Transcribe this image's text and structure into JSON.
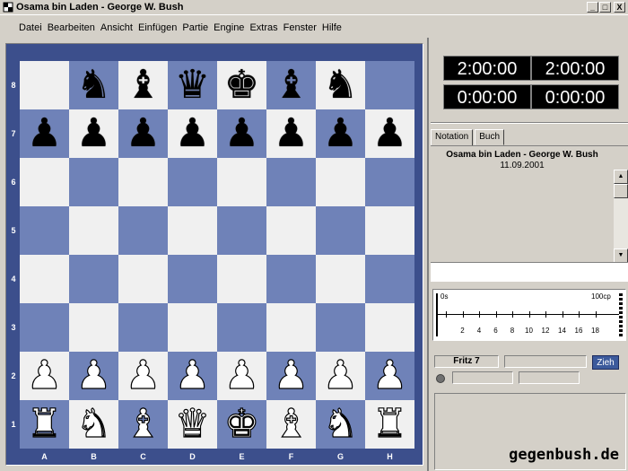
{
  "window": {
    "title": "Osama bin Laden - George W. Bush",
    "controls": {
      "minimize": "_",
      "maximize": "□",
      "close": "X"
    }
  },
  "menu": [
    "Datei",
    "Bearbeiten",
    "Ansicht",
    "Einfügen",
    "Partie",
    "Engine",
    "Extras",
    "Fenster",
    "Hilfe"
  ],
  "board": {
    "ranks": [
      "8",
      "7",
      "6",
      "5",
      "4",
      "3",
      "2",
      "1"
    ],
    "files": [
      "A",
      "B",
      "C",
      "D",
      "E",
      "F",
      "G",
      "H"
    ],
    "position": [
      [
        "",
        "black-knight",
        "black-bishop",
        "black-queen",
        "black-king",
        "black-bishop",
        "black-knight",
        ""
      ],
      [
        "black-pawn",
        "black-pawn",
        "black-pawn",
        "black-pawn",
        "black-pawn",
        "black-pawn",
        "black-pawn",
        "black-pawn"
      ],
      [
        "",
        "",
        "",
        "",
        "",
        "",
        "",
        ""
      ],
      [
        "",
        "",
        "",
        "",
        "",
        "",
        "",
        ""
      ],
      [
        "",
        "",
        "",
        "",
        "",
        "",
        "",
        ""
      ],
      [
        "",
        "",
        "",
        "",
        "",
        "",
        "",
        ""
      ],
      [
        "white-pawn",
        "white-pawn",
        "white-pawn",
        "white-pawn",
        "white-pawn",
        "white-pawn",
        "white-pawn",
        "white-pawn"
      ],
      [
        "white-rook",
        "white-knight",
        "white-bishop",
        "white-queen",
        "white-king",
        "white-bishop",
        "white-knight",
        "white-rook"
      ]
    ],
    "colors": {
      "light": "#f0f0f0",
      "dark": "#6f82b8",
      "frame": "#3c4f8c"
    }
  },
  "clocks": [
    "2:00:00",
    "2:00:00",
    "0:00:00",
    "0:00:00"
  ],
  "tabs": [
    "Notation",
    "Buch"
  ],
  "notation": {
    "game_title": "Osama bin Laden - George W. Bush",
    "date": "11.09.2001"
  },
  "evaluation": {
    "start_label": "0s",
    "end_label": "100cp",
    "ticks": [
      "2",
      "4",
      "6",
      "8",
      "10",
      "12",
      "14",
      "16",
      "18"
    ]
  },
  "engine": {
    "name": "Fritz 7",
    "go_label": "Zieh"
  },
  "watermark": "gegenbush.de"
}
